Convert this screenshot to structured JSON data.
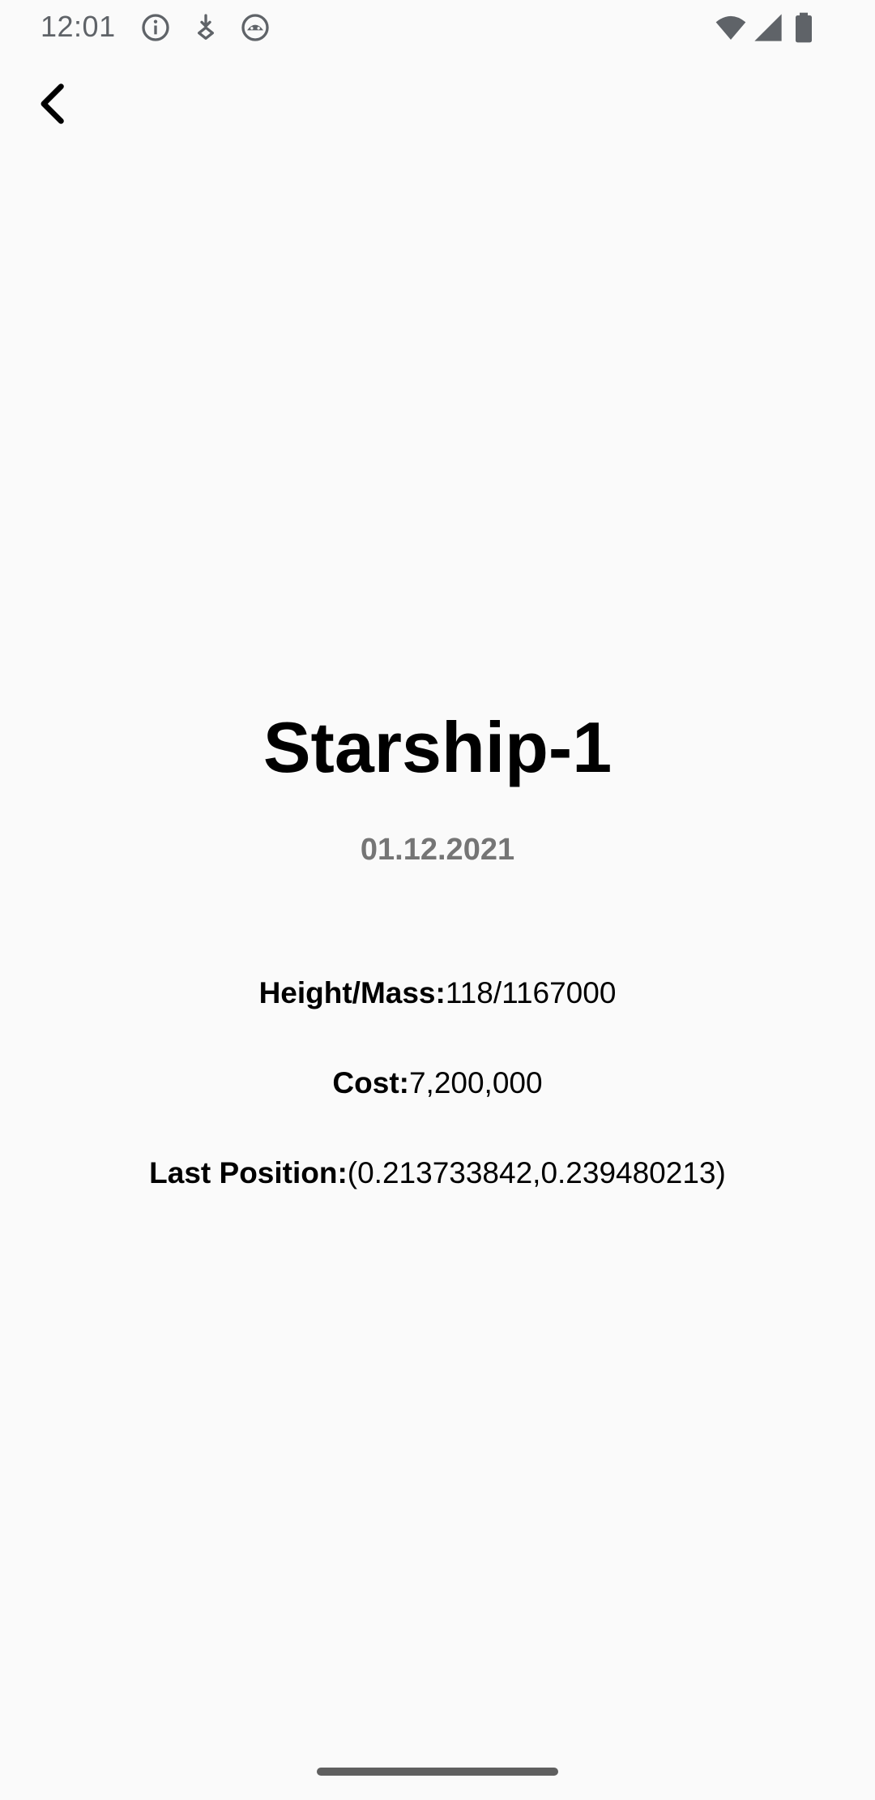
{
  "status_bar": {
    "time": "12:01",
    "left_icons": [
      "info-icon",
      "download-arrow-icon",
      "robot-icon"
    ],
    "right_icons": [
      "wifi-icon",
      "cellular-signal-icon",
      "battery-icon"
    ],
    "icon_color": "#5f6368"
  },
  "toolbar": {
    "back_icon": "back-arrow-icon"
  },
  "ship": {
    "name": "Starship-1",
    "date": "01.12.2021",
    "height_mass_label": "Height/Mass:",
    "height_mass_value": "118/1167000",
    "cost_label": "Cost:",
    "cost_value": "7,200,000",
    "last_position_label": "Last Position:",
    "last_position_value": "(0.213733842,0.239480213)"
  },
  "colors": {
    "background": "#fafafa",
    "date_text": "#757575"
  }
}
